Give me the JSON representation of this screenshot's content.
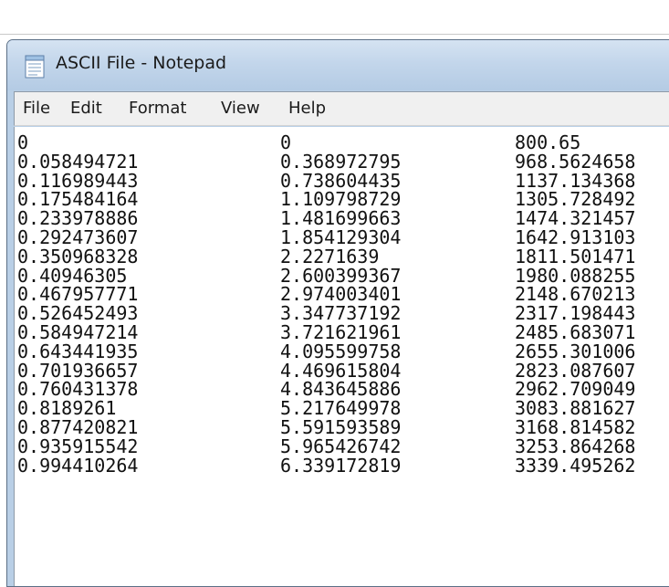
{
  "window": {
    "title": "ASCII File - Notepad",
    "icon": "notepad-icon"
  },
  "menu": {
    "items": [
      "File",
      "Edit",
      "Format",
      "View",
      "Help"
    ]
  },
  "document": {
    "rows": [
      [
        "0",
        "0",
        "800.65"
      ],
      [
        "0.058494721",
        "0.368972795",
        "968.5624658"
      ],
      [
        "0.116989443",
        "0.738604435",
        "1137.134368"
      ],
      [
        "0.175484164",
        "1.109798729",
        "1305.728492"
      ],
      [
        "0.233978886",
        "1.481699663",
        "1474.321457"
      ],
      [
        "0.292473607",
        "1.854129304",
        "1642.913103"
      ],
      [
        "0.350968328",
        "2.2271639",
        "1811.501471"
      ],
      [
        "0.40946305",
        "2.600399367",
        "1980.088255"
      ],
      [
        "0.467957771",
        "2.974003401",
        "2148.670213"
      ],
      [
        "0.526452493",
        "3.347737192",
        "2317.198443"
      ],
      [
        "0.584947214",
        "3.721621961",
        "2485.683071"
      ],
      [
        "0.643441935",
        "4.095599758",
        "2655.301006"
      ],
      [
        "0.701936657",
        "4.469615804",
        "2823.087607"
      ],
      [
        "0.760431378",
        "4.843645886",
        "2962.709049"
      ],
      [
        "0.8189261",
        "5.217649978",
        "3083.881627"
      ],
      [
        "0.877420821",
        "5.591593589",
        "3168.814582"
      ],
      [
        "0.935915542",
        "5.965426742",
        "3253.864268"
      ],
      [
        "0.994410264",
        "6.339172819",
        "3339.495262"
      ]
    ]
  }
}
